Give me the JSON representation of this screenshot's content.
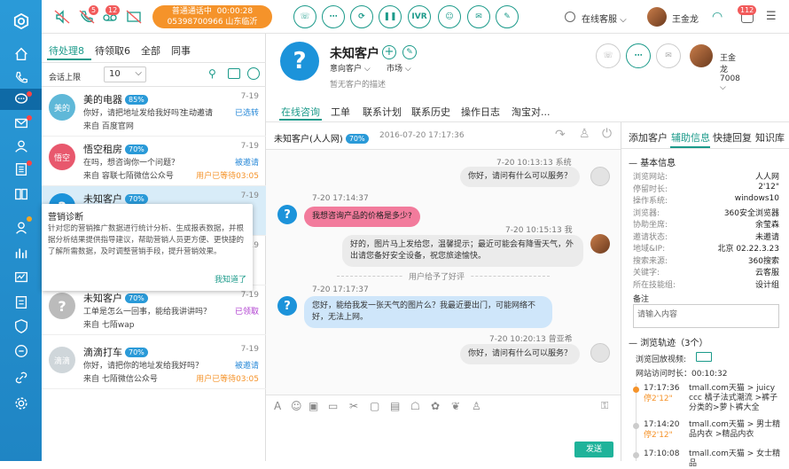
{
  "topbar": {
    "call_status": "普通通话中",
    "call_time": "00:00:28",
    "call_number": "05398700966 山东临沂",
    "badge_missed": "5",
    "badge_voice": "12",
    "ivr": "IVR",
    "status_label": "在线客服",
    "agent_name": "王金龙",
    "notify_count": "112"
  },
  "left": {
    "tabs": [
      "待处理8",
      "待领取6",
      "全部",
      "同事"
    ],
    "limit_label": "会话上限",
    "limit_value": "10",
    "conversations": [
      {
        "avatar": "美的",
        "name": "美的电器",
        "pct": "85%",
        "date": "7-19",
        "msg": "你好，请把地址发给我好吗？",
        "from": "来自 百度官网",
        "status_a": "主动邀请",
        "status_b": "已选转",
        "color": "#5fb8d8"
      },
      {
        "avatar": "悟空",
        "name": "悟空租房",
        "pct": "70%",
        "date": "7-19",
        "msg": "在吗，想咨询你一个问题？",
        "from": "来自 容联七陌微信公众号",
        "status_a": "被邀请",
        "status_b": "用户已等待03:05",
        "color": "#e8586d"
      },
      {
        "avatar": "",
        "name": "未知客户",
        "pct": "70%",
        "date": "7-19",
        "msg": "",
        "from": "",
        "status_a": "",
        "status_b": "",
        "color": "#1c93da"
      },
      {
        "avatar": "",
        "name": "",
        "pct": "",
        "date": "7-19",
        "msg": "",
        "from": "",
        "status_a": "",
        "status_b": "",
        "color": "#ccc"
      },
      {
        "avatar": "",
        "name": "未知客户",
        "pct": "70%",
        "date": "7-19",
        "msg": "工单是怎么一回事，能给我讲讲吗？",
        "from": "来自 七陌wap",
        "status_a": "已领取",
        "status_b": "",
        "color": "#bbb"
      },
      {
        "avatar": "滴滴",
        "name": "滴滴打车",
        "pct": "70%",
        "date": "7-19",
        "msg": "你好，请把你的地址发给我好吗？",
        "from": "来自 七陌微信公众号",
        "status_a": "被邀请",
        "status_b": "用户已等待03:05",
        "color": "#cfd6da"
      }
    ],
    "popup": {
      "title": "营销诊断",
      "body": "针对您的营销推广数据进行统计分析、生成报表数据，并根据分析结果提供指导建议，帮助营销人员更方便、更快捷的了解所需数据，及时调整营销手段，提升营销效果。",
      "ack": "我知道了"
    }
  },
  "customer": {
    "name": "未知客户",
    "tag_intent": "意向客户",
    "tag_market": "市场",
    "desc": "暂无客户的描述",
    "agent": "王金龙7008"
  },
  "mid": {
    "tabs": [
      "在线咨询",
      "工单",
      "联系计划",
      "联系历史",
      "操作日志",
      "淘宝对..."
    ],
    "chat_title": "未知客户(人人网)",
    "chat_pct": "70%",
    "chat_time": "2016-07-20 17:17:36",
    "messages": [
      {
        "meta": "7-20  10:13:13  系统",
        "text": "你好，请问有什么可以服务？"
      },
      {
        "meta": "7-20  17:14:37",
        "text": "我想咨询产品的价格是多少?"
      },
      {
        "meta": "7-20  10:15:13  我",
        "text": "好的，图片马上发给您，温馨提示；最近可能会有降雪天气，外出请您备好安全设备，祝您旅途愉快。"
      },
      {
        "meta": "用户给予了好评",
        "text": ""
      },
      {
        "meta": "7-20  17:17:37",
        "text": "您好，能给我发一张天气的图片么？我最近要出门，可能网络不好，无法上网。"
      },
      {
        "meta": "7-20  10:20:13  曾亚希",
        "text": "你好，请问有什么可以服务？"
      }
    ],
    "send": "发送"
  },
  "right": {
    "tabs": [
      "添加客户",
      "辅助信息",
      "快捷回复",
      "知识库"
    ],
    "basic_title": "基本信息",
    "info": [
      [
        "浏览网站:",
        "人人网"
      ],
      [
        "停留时长:",
        "2'12\""
      ],
      [
        "操作系统:",
        "windows10"
      ],
      [
        "浏览器:",
        "360安全浏览器"
      ],
      [
        "协助坐席:",
        "余莹森"
      ],
      [
        "邀请状态:",
        "未邀请"
      ],
      [
        "地域&IP:",
        "北京 02.22.3.23"
      ],
      [
        "搜索来源:",
        "360搜索"
      ],
      [
        "关键字:",
        "云客服"
      ],
      [
        "所在技能组:",
        "设计组"
      ]
    ],
    "note_label": "备注",
    "note_placeholder": "请输入内容",
    "track_title": "浏览轨迹（3个）",
    "replay_label": "浏览回放视频:",
    "visit_label": "网站访问时长：",
    "visit_time": "00:10:32",
    "tracks": [
      {
        "time": "17:17:36",
        "stay": "停2'12\"",
        "text": "tmall.com天猫 > juicy ccc 橘子法式潮流 >裤子分类的>萝卜裤大全"
      },
      {
        "time": "17:14:20",
        "stay": "停2'12\"",
        "text": "tmall.com天猫 > 男士精品内衣 >精品内衣"
      },
      {
        "time": "17:10:08",
        "stay": "",
        "text": "tmall.com天猫 > 女士精品"
      }
    ]
  }
}
